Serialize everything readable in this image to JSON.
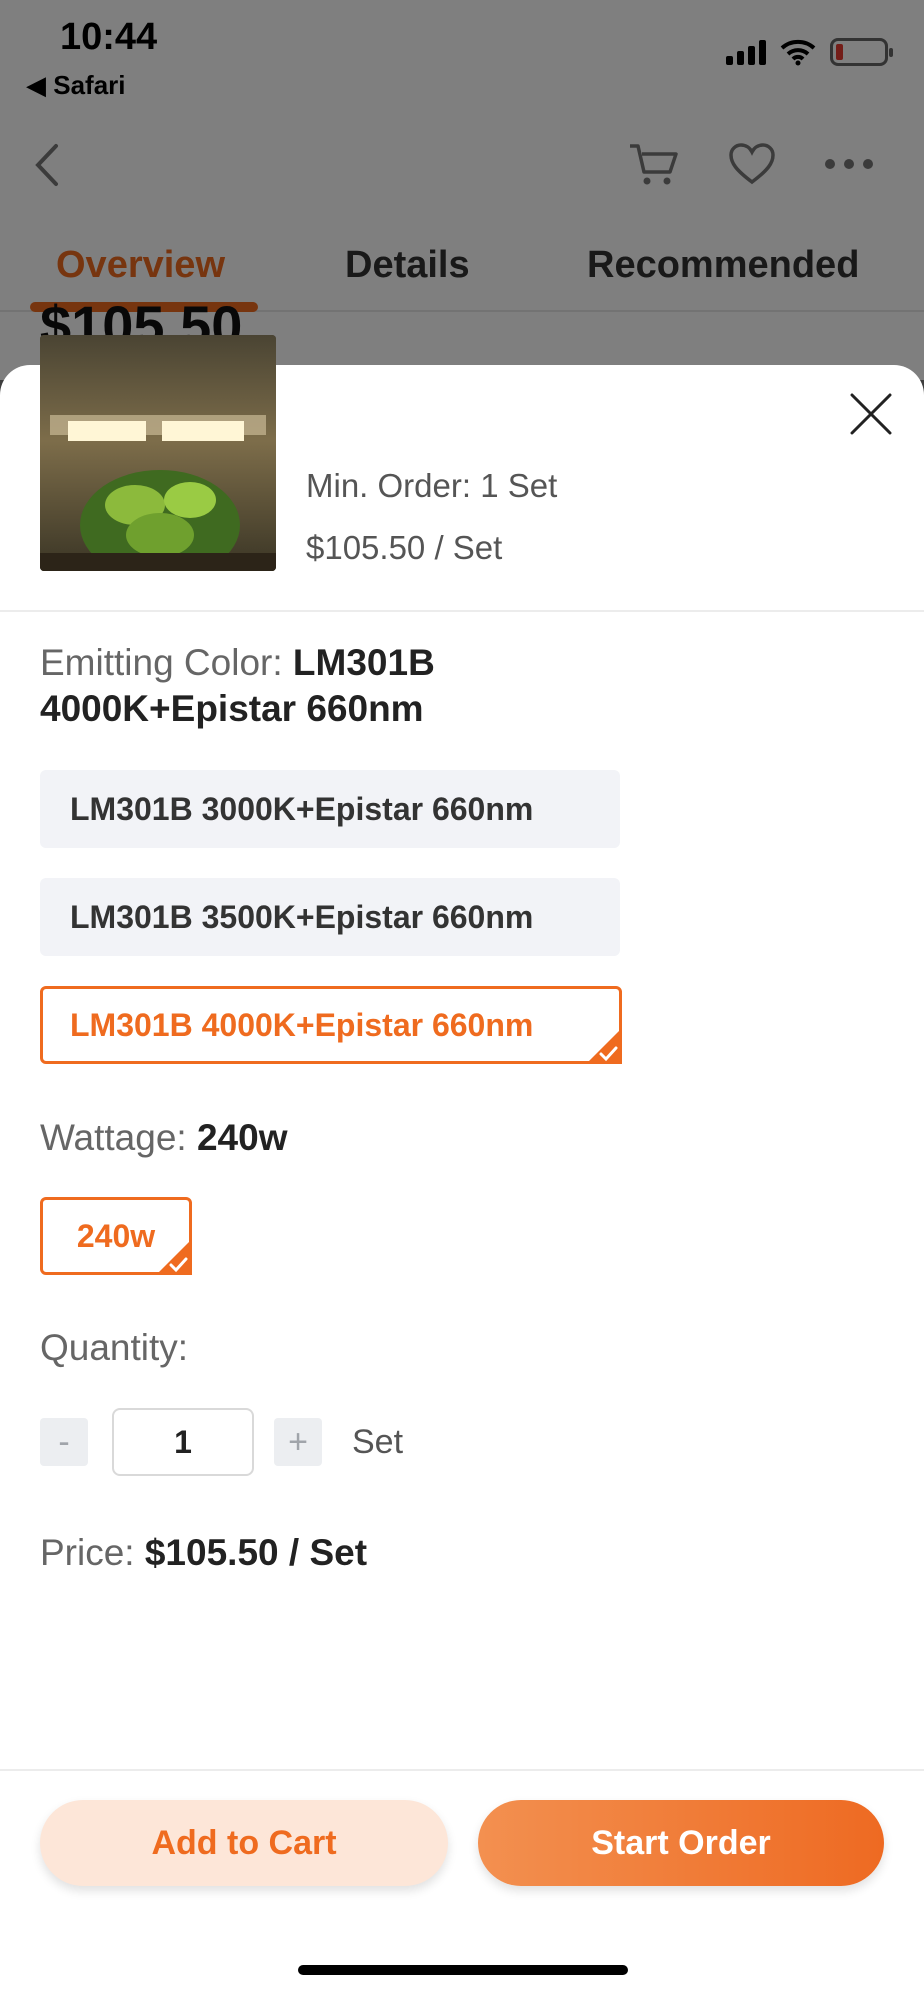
{
  "status_bar": {
    "time": "10:44",
    "back_app": "Safari"
  },
  "tabs": [
    {
      "label": "Overview",
      "active": true
    },
    {
      "label": "Details",
      "active": false
    },
    {
      "label": "Recommended",
      "active": false
    }
  ],
  "background_price": "$105.50",
  "product": {
    "min_order": "Min. Order: 1 Set",
    "unit_price": "$105.50 / Set"
  },
  "emitting_color": {
    "label": "Emitting Color:",
    "selected": "LM301B 4000K+Epistar 660nm",
    "options": [
      "LM301B 3000K+Epistar 660nm",
      "LM301B 3500K+Epistar 660nm",
      "LM301B 4000K+Epistar 660nm"
    ]
  },
  "wattage": {
    "label": "Wattage:",
    "selected": "240w",
    "options": [
      "240w"
    ]
  },
  "quantity": {
    "label": "Quantity:",
    "minus": "-",
    "plus": "+",
    "value": "1",
    "unit": "Set"
  },
  "price": {
    "label": "Price:",
    "value": "$105.50 / Set"
  },
  "buttons": {
    "add_to_cart": "Add to Cart",
    "start_order": "Start Order"
  },
  "colors": {
    "accent": "#ef6b1f",
    "accent_light": "#fde6d8"
  }
}
